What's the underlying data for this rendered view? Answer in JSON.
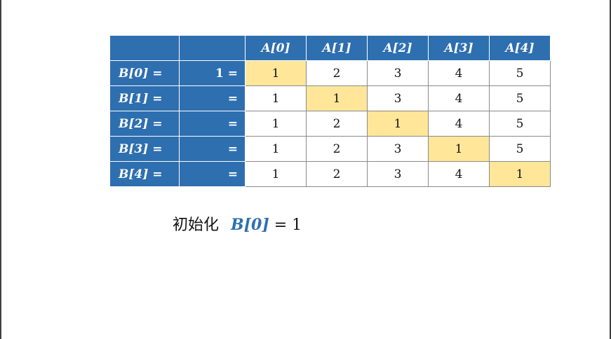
{
  "table": {
    "header": [
      "A[0]",
      "A[1]",
      "A[2]",
      "A[3]",
      "A[4]"
    ],
    "rows": [
      {
        "label": "B[0] =",
        "prefix": "1 =",
        "values": [
          "1",
          "2",
          "3",
          "4",
          "5"
        ],
        "highlight": 0
      },
      {
        "label": "B[1] =",
        "prefix": "=",
        "values": [
          "1",
          "1",
          "3",
          "4",
          "5"
        ],
        "highlight": 1
      },
      {
        "label": "B[2] =",
        "prefix": "=",
        "values": [
          "1",
          "2",
          "1",
          "4",
          "5"
        ],
        "highlight": 2
      },
      {
        "label": "B[3] =",
        "prefix": "=",
        "values": [
          "1",
          "2",
          "3",
          "1",
          "5"
        ],
        "highlight": 3
      },
      {
        "label": "B[4] =",
        "prefix": "=",
        "values": [
          "1",
          "2",
          "3",
          "4",
          "1"
        ],
        "highlight": 4
      }
    ]
  },
  "caption": {
    "text": "初始化",
    "variable": "B[0]",
    "rest": "= 1"
  },
  "colors": {
    "header_bg": "#2e6fb0",
    "highlight_bg": "#ffe699"
  }
}
